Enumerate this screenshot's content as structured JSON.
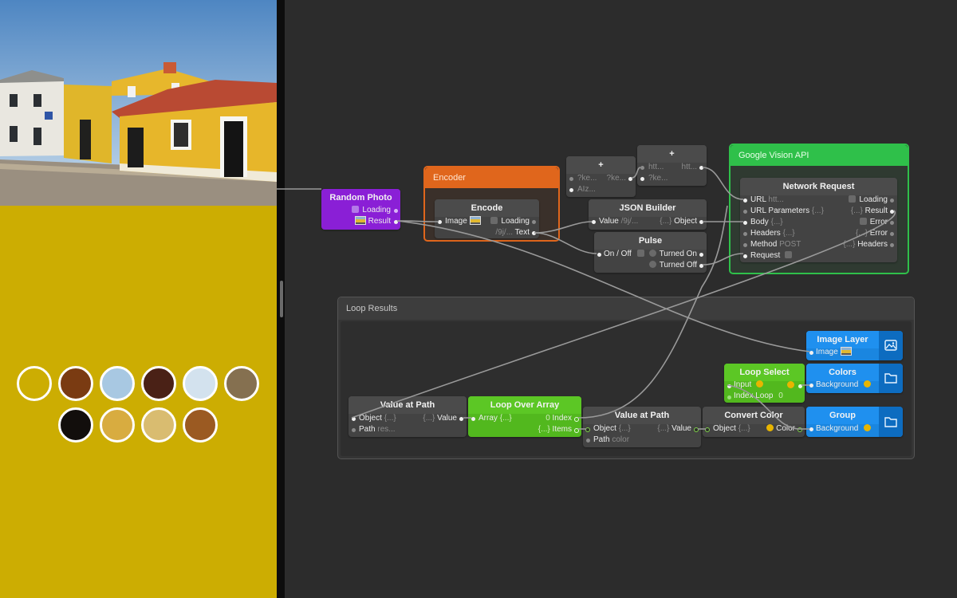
{
  "colors": {
    "background_canvas": "#2c2c2c",
    "preview_background": "#ccad02",
    "node_body": "#434343",
    "node_header": "#4b4b4b",
    "random_photo_purple": "#8a1fd6",
    "encoder_orange": "#e0661c",
    "google_green": "#2fc04a",
    "loop_green": "#52b81e",
    "layer_blue": "#1a86e0"
  },
  "preview": {
    "palette": [
      "#ccad02",
      "#7a3b12",
      "#a8c8e2",
      "#4a2116",
      "#d3e2ee",
      "#857050",
      "#120e0c",
      "#d8ac40",
      "#d9bc70",
      "#9b5a22"
    ]
  },
  "groups": {
    "encoder": {
      "title": "Encoder"
    },
    "google_vision": {
      "title": "Google Vision API"
    },
    "loop_results": {
      "title": "Loop Results"
    }
  },
  "nodes": {
    "random_photo": {
      "title": "Random Photo",
      "loading": "Loading",
      "result": "Result"
    },
    "encode": {
      "title": "Encode",
      "image": "Image",
      "loading": "Loading",
      "text_val": "/9j/...",
      "text": "Text"
    },
    "plus1": {
      "title": "+",
      "in1": "?ke...",
      "out1": "?ke...",
      "in2": "AIz..."
    },
    "plus2": {
      "title": "+",
      "in1": "htt...",
      "out1": "htt...",
      "in2": "?ke..."
    },
    "json_builder": {
      "title": "JSON Builder",
      "value": "Value",
      "value_val": "/9j/...",
      "object_val": "{...}",
      "object": "Object"
    },
    "pulse": {
      "title": "Pulse",
      "onoff": "On / Off",
      "turned_on": "Turned On",
      "turned_off": "Turned Off"
    },
    "network_request": {
      "title": "Network Request",
      "url": "URL",
      "url_val": "htt...",
      "loading": "Loading",
      "url_params": "URL Parameters",
      "url_params_val": "{...}",
      "result_val": "{...}",
      "result": "Result",
      "body": "Body",
      "body_val": "{...}",
      "error_out": "Error",
      "headers": "Headers",
      "headers_val": "{...}",
      "error2": "Error",
      "method": "Method",
      "method_val": "POST",
      "headers_out_val": "{...}",
      "headers_out": "Headers",
      "request": "Request"
    },
    "value_at_path_1": {
      "title": "Value at Path",
      "object": "Object",
      "object_val": "{...}",
      "value_val": "{...}",
      "value": "Value",
      "path": "Path",
      "path_val": "res..."
    },
    "loop_over_array": {
      "title": "Loop Over Array",
      "array": "Array",
      "array_val": "{...}",
      "index_val": "0",
      "index": "Index",
      "items_val": "{...}",
      "items": "Items"
    },
    "value_at_path_2": {
      "title": "Value at Path",
      "object": "Object",
      "object_val": "{...}",
      "value_val": "{...}",
      "value": "Value",
      "path": "Path",
      "path_val": "color"
    },
    "convert_color": {
      "title": "Convert Color",
      "object": "Object",
      "object_val": "{...}",
      "color": "Color"
    },
    "loop_select": {
      "title": "Loop Select",
      "input": "Input",
      "index_loop": "Index Loop",
      "index_loop_val": "0"
    },
    "image_layer": {
      "title": "Image Layer",
      "image": "Image"
    },
    "colors": {
      "title": "Colors",
      "background": "Background"
    },
    "group": {
      "title": "Group",
      "background": "Background"
    }
  }
}
